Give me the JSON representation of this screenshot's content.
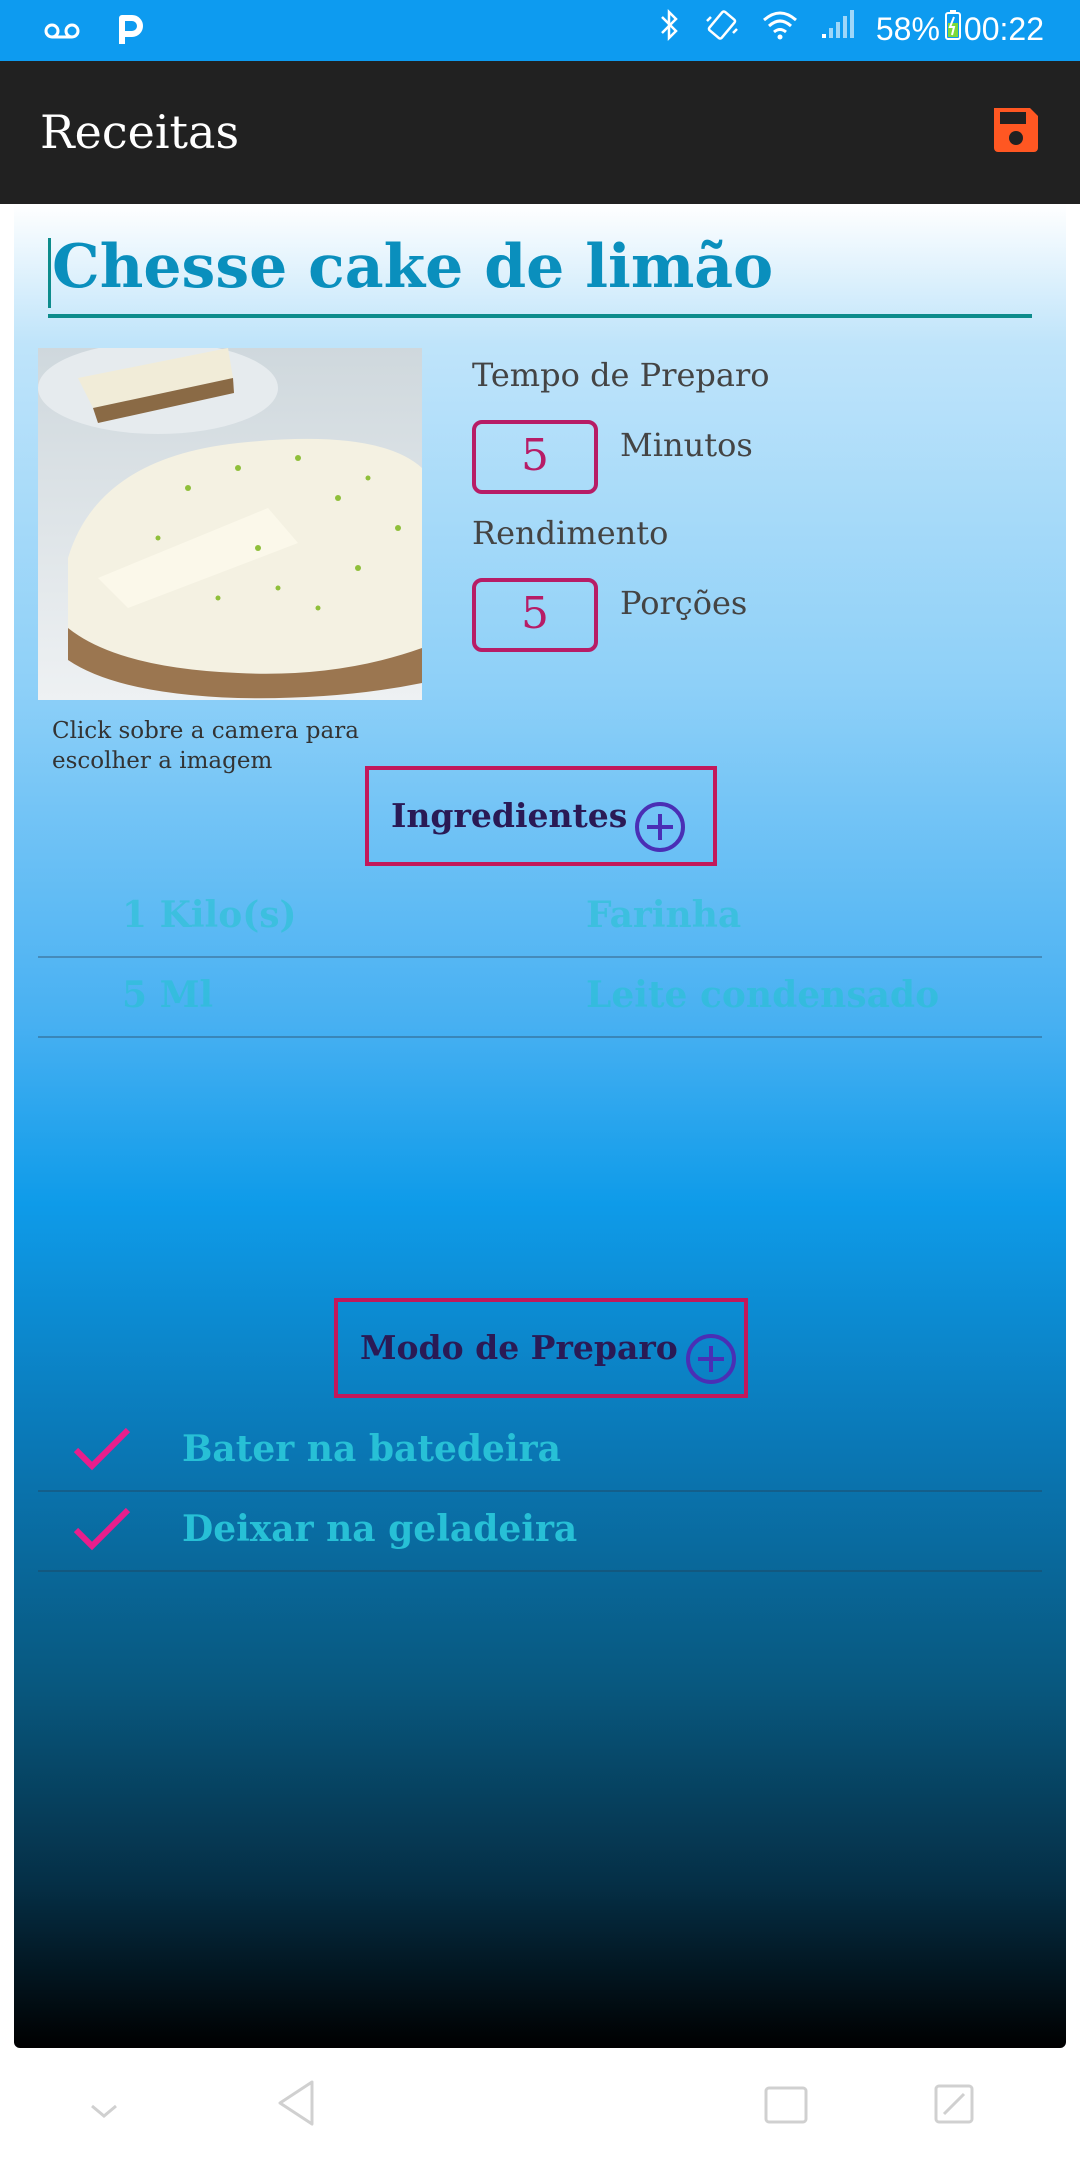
{
  "status_bar": {
    "battery": "58%",
    "time": "00:22"
  },
  "app_bar": {
    "title": "Receitas"
  },
  "recipe": {
    "title": "Chesse cake de limão",
    "photo_caption": "Click sobre a camera para escolher a imagem",
    "prep_time_label": "Tempo de Preparo",
    "prep_time_value": "5",
    "prep_time_unit": "Minutos",
    "yield_label": "Rendimento",
    "yield_value": "5",
    "yield_unit": "Porções"
  },
  "ingredients": {
    "button_label": "Ingredientes",
    "items": [
      {
        "quantity": "1 Kilo(s)",
        "name": "Farinha"
      },
      {
        "quantity": "5 Ml",
        "name": "Leite condensado"
      }
    ]
  },
  "preparation": {
    "button_label": "Modo de Preparo",
    "steps": [
      {
        "text": "Bater na batedeira"
      },
      {
        "text": "Deixar na geladeira"
      }
    ]
  },
  "colors": {
    "status_bar": "#0d9bf0",
    "app_bar": "#212121",
    "save_icon": "#ff5722",
    "accent_border": "#c2185b",
    "check": "#e91e8c",
    "list_text": "#27c0d6"
  },
  "icons": {
    "save": "floppy-disk-icon",
    "add": "plus-circle-icon",
    "check": "check-icon"
  }
}
